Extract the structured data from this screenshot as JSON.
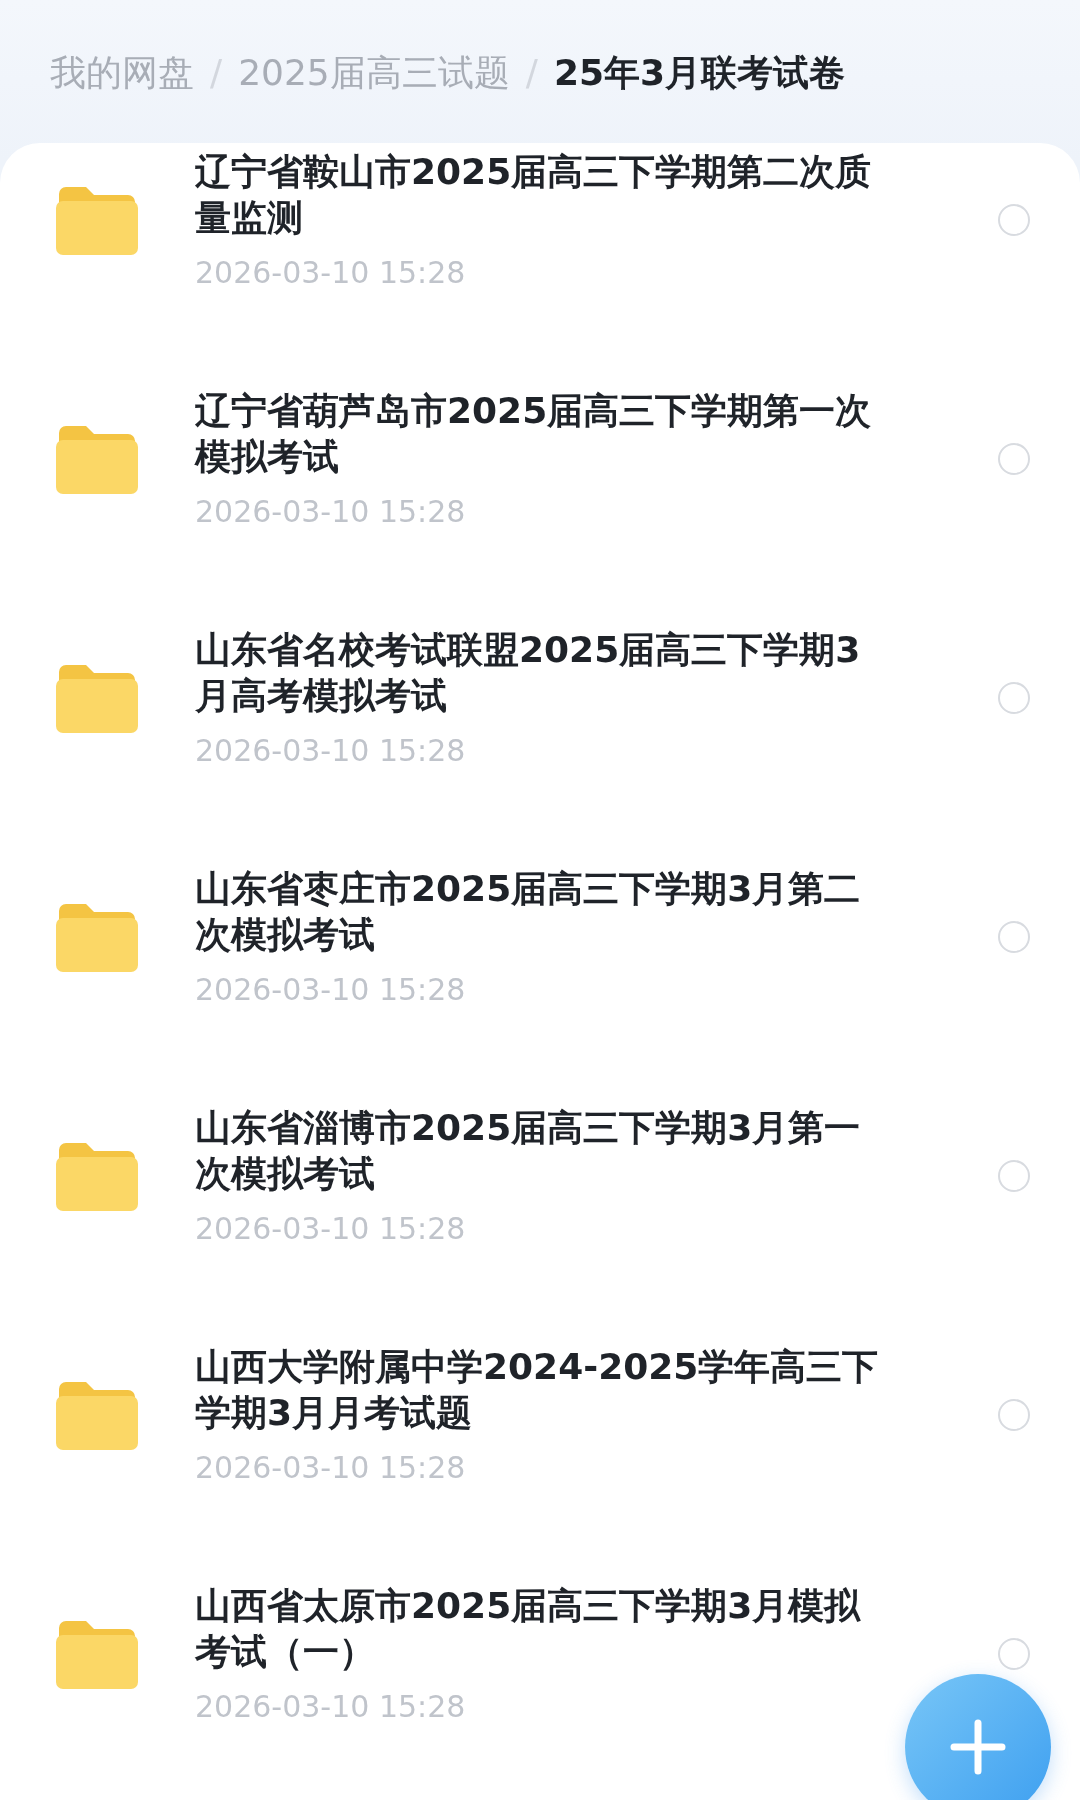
{
  "breadcrumb": [
    {
      "label": "我的网盘",
      "selected": false
    },
    {
      "label": "2025届高三试题",
      "selected": false
    },
    {
      "label": "25年3月联考试卷",
      "selected": true
    }
  ],
  "separator": "/",
  "files": [
    {
      "name": "辽宁省鞍山市2025届高三下学期第二次质量监测",
      "date": "2026-03-10 15:28",
      "selected": false
    },
    {
      "name": "辽宁省葫芦岛市2025届高三下学期第一次模拟考试",
      "date": "2026-03-10 15:28",
      "selected": false
    },
    {
      "name": "山东省名校考试联盟2025届高三下学期3月高考模拟考试",
      "date": "2026-03-10 15:28",
      "selected": false
    },
    {
      "name": "山东省枣庄市2025届高三下学期3月第二次模拟考试",
      "date": "2026-03-10 15:28",
      "selected": false
    },
    {
      "name": "山东省淄博市2025届高三下学期3月第一次模拟考试",
      "date": "2026-03-10 15:28",
      "selected": false
    },
    {
      "name": "山西大学附属中学2024-2025学年高三下学期3月月考试题",
      "date": "2026-03-10 15:28",
      "selected": false
    },
    {
      "name": "山西省太原市2025届高三下学期3月模拟考试（一）",
      "date": "2026-03-10 15:28",
      "selected": false
    }
  ]
}
